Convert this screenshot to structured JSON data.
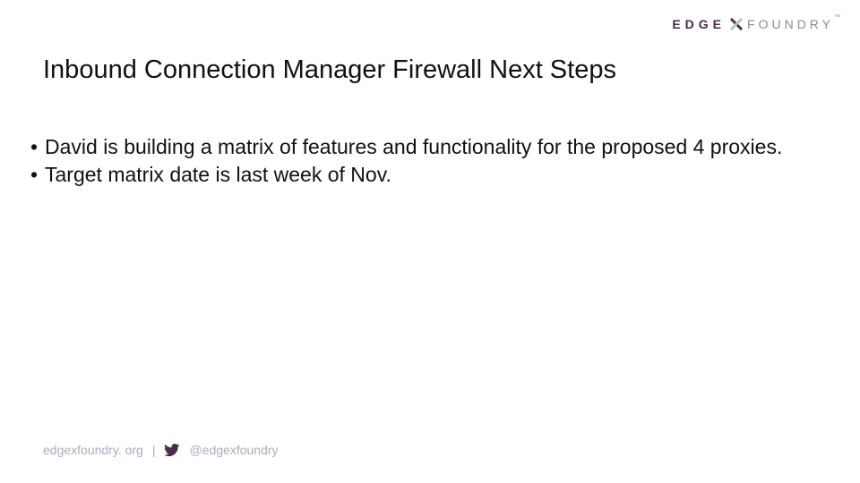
{
  "brand": {
    "left": "EDGE",
    "right": "FOUNDRY",
    "tm": "™"
  },
  "title": "Inbound Connection Manager Firewall Next Steps",
  "bullets": [
    "David is building a matrix of features and functionality for the proposed 4 proxies.",
    "Target matrix date is last week of Nov."
  ],
  "footer": {
    "site": "edgexfoundry. org",
    "separator": "|",
    "handle": "@edgexfoundry"
  }
}
